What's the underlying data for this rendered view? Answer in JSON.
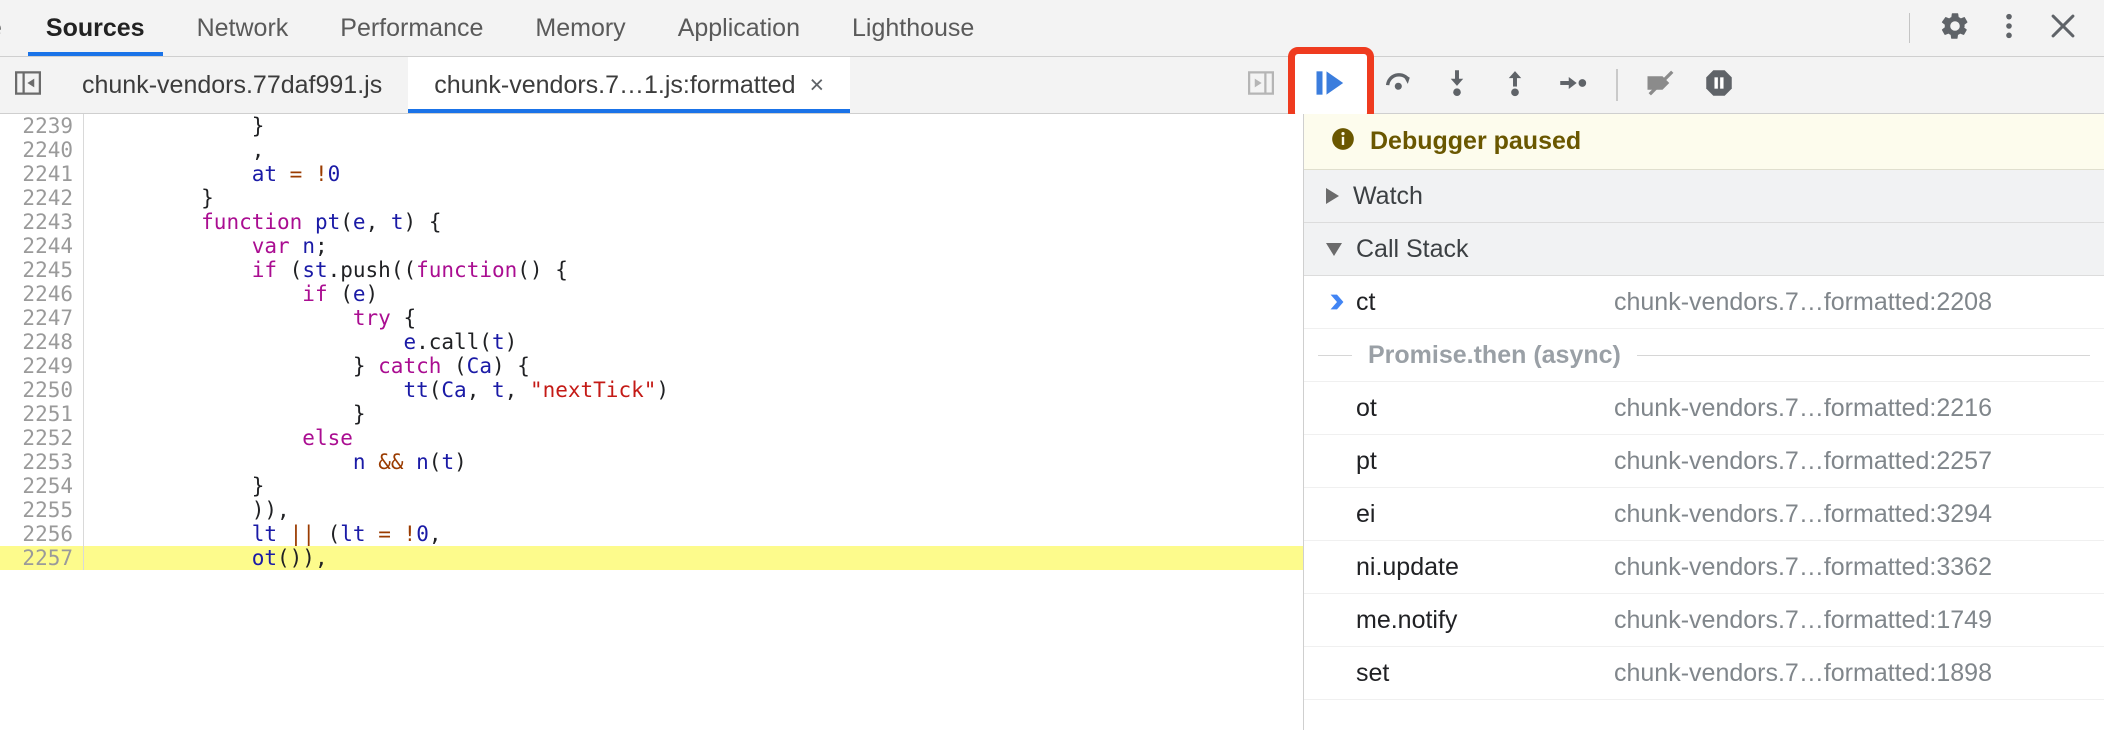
{
  "panel_tabs": [
    {
      "label": "e",
      "selected": false,
      "clipped": true
    },
    {
      "label": "Sources",
      "selected": true
    },
    {
      "label": "Network",
      "selected": false
    },
    {
      "label": "Performance",
      "selected": false
    },
    {
      "label": "Memory",
      "selected": false
    },
    {
      "label": "Application",
      "selected": false
    },
    {
      "label": "Lighthouse",
      "selected": false
    }
  ],
  "panel_actions": {
    "settings": "gear-icon",
    "more": "kebab-menu-icon",
    "close": "close-icon"
  },
  "file_tabs": {
    "navigator_toggle": "show-navigator-icon",
    "tabs": [
      {
        "label": "chunk-vendors.77daf991.js",
        "active": false,
        "closable": false
      },
      {
        "label": "chunk-vendors.7…1.js:formatted",
        "active": true,
        "closable": true,
        "close_glyph": "×"
      }
    ]
  },
  "debugger_toolbar": {
    "buttons": [
      {
        "name": "show-debugger-sidebar",
        "title": "Show debugger sidebar",
        "highlighted": false
      },
      {
        "name": "resume-script-execution",
        "title": "Resume script execution",
        "highlighted": true
      },
      {
        "name": "step-over-next-function-call",
        "title": "Step over next function call",
        "highlighted": false
      },
      {
        "name": "step-into-next-function-call",
        "title": "Step into next function call",
        "highlighted": false
      },
      {
        "name": "step-out-of-current-function",
        "title": "Step out of current function",
        "highlighted": false
      },
      {
        "name": "step",
        "title": "Step",
        "highlighted": false
      },
      {
        "name": "deactivate-breakpoints",
        "title": "Deactivate breakpoints",
        "highlighted": false
      },
      {
        "name": "pause-on-exceptions",
        "title": "Pause on exceptions",
        "highlighted": false
      }
    ],
    "annotation_color": "#ef3b1f",
    "resume_color": "#3b7ddd"
  },
  "editor": {
    "execution_line": 2257,
    "execution_highlight_color": "#fdfb8c",
    "lines": [
      {
        "n": 2239,
        "tokens": [
          {
            "t": "            }",
            "c": "p"
          }
        ]
      },
      {
        "n": 2240,
        "tokens": [
          {
            "t": "            ,",
            "c": "p"
          }
        ]
      },
      {
        "n": 2241,
        "tokens": [
          {
            "t": "            ",
            "c": "p"
          },
          {
            "t": "at",
            "c": "v"
          },
          {
            "t": " ",
            "c": "p"
          },
          {
            "t": "=",
            "c": "o"
          },
          {
            "t": " ",
            "c": "p"
          },
          {
            "t": "!",
            "c": "o"
          },
          {
            "t": "0",
            "c": "v"
          }
        ]
      },
      {
        "n": 2242,
        "tokens": [
          {
            "t": "        }",
            "c": "p"
          }
        ]
      },
      {
        "n": 2243,
        "tokens": [
          {
            "t": "        ",
            "c": "p"
          },
          {
            "t": "function",
            "c": "k"
          },
          {
            "t": " ",
            "c": "p"
          },
          {
            "t": "pt",
            "c": "v"
          },
          {
            "t": "(",
            "c": "p"
          },
          {
            "t": "e",
            "c": "v"
          },
          {
            "t": ", ",
            "c": "p"
          },
          {
            "t": "t",
            "c": "v"
          },
          {
            "t": ") {",
            "c": "p"
          }
        ]
      },
      {
        "n": 2244,
        "tokens": [
          {
            "t": "            ",
            "c": "p"
          },
          {
            "t": "var",
            "c": "k"
          },
          {
            "t": " ",
            "c": "p"
          },
          {
            "t": "n",
            "c": "v"
          },
          {
            "t": ";",
            "c": "p"
          }
        ]
      },
      {
        "n": 2245,
        "tokens": [
          {
            "t": "            ",
            "c": "p"
          },
          {
            "t": "if",
            "c": "k"
          },
          {
            "t": " (",
            "c": "p"
          },
          {
            "t": "st",
            "c": "v"
          },
          {
            "t": ".push((",
            "c": "p"
          },
          {
            "t": "function",
            "c": "k"
          },
          {
            "t": "() {",
            "c": "p"
          }
        ]
      },
      {
        "n": 2246,
        "tokens": [
          {
            "t": "                ",
            "c": "p"
          },
          {
            "t": "if",
            "c": "k"
          },
          {
            "t": " (",
            "c": "p"
          },
          {
            "t": "e",
            "c": "v"
          },
          {
            "t": ")",
            "c": "p"
          }
        ]
      },
      {
        "n": 2247,
        "tokens": [
          {
            "t": "                    ",
            "c": "p"
          },
          {
            "t": "try",
            "c": "k"
          },
          {
            "t": " {",
            "c": "p"
          }
        ]
      },
      {
        "n": 2248,
        "tokens": [
          {
            "t": "                        ",
            "c": "p"
          },
          {
            "t": "e",
            "c": "v"
          },
          {
            "t": ".call(",
            "c": "p"
          },
          {
            "t": "t",
            "c": "v"
          },
          {
            "t": ")",
            "c": "p"
          }
        ]
      },
      {
        "n": 2249,
        "tokens": [
          {
            "t": "                    } ",
            "c": "p"
          },
          {
            "t": "catch",
            "c": "k"
          },
          {
            "t": " (",
            "c": "p"
          },
          {
            "t": "Ca",
            "c": "v"
          },
          {
            "t": ") {",
            "c": "p"
          }
        ]
      },
      {
        "n": 2250,
        "tokens": [
          {
            "t": "                        ",
            "c": "p"
          },
          {
            "t": "tt",
            "c": "v"
          },
          {
            "t": "(",
            "c": "p"
          },
          {
            "t": "Ca",
            "c": "v"
          },
          {
            "t": ", ",
            "c": "p"
          },
          {
            "t": "t",
            "c": "v"
          },
          {
            "t": ", ",
            "c": "p"
          },
          {
            "t": "\"nextTick\"",
            "c": "s"
          },
          {
            "t": ")",
            "c": "p"
          }
        ]
      },
      {
        "n": 2251,
        "tokens": [
          {
            "t": "                    }",
            "c": "p"
          }
        ]
      },
      {
        "n": 2252,
        "tokens": [
          {
            "t": "                ",
            "c": "p"
          },
          {
            "t": "else",
            "c": "k"
          }
        ]
      },
      {
        "n": 2253,
        "tokens": [
          {
            "t": "                    ",
            "c": "p"
          },
          {
            "t": "n",
            "c": "v"
          },
          {
            "t": " ",
            "c": "p"
          },
          {
            "t": "&&",
            "c": "o"
          },
          {
            "t": " ",
            "c": "p"
          },
          {
            "t": "n",
            "c": "v"
          },
          {
            "t": "(",
            "c": "p"
          },
          {
            "t": "t",
            "c": "v"
          },
          {
            "t": ")",
            "c": "p"
          }
        ]
      },
      {
        "n": 2254,
        "tokens": [
          {
            "t": "            }",
            "c": "p"
          }
        ]
      },
      {
        "n": 2255,
        "tokens": [
          {
            "t": "            )),",
            "c": "p"
          }
        ]
      },
      {
        "n": 2256,
        "tokens": [
          {
            "t": "            ",
            "c": "p"
          },
          {
            "t": "lt",
            "c": "v"
          },
          {
            "t": " ",
            "c": "p"
          },
          {
            "t": "||",
            "c": "o"
          },
          {
            "t": " (",
            "c": "p"
          },
          {
            "t": "lt",
            "c": "v"
          },
          {
            "t": " ",
            "c": "p"
          },
          {
            "t": "=",
            "c": "o"
          },
          {
            "t": " ",
            "c": "p"
          },
          {
            "t": "!",
            "c": "o"
          },
          {
            "t": "0",
            "c": "v"
          },
          {
            "t": ",",
            "c": "p"
          }
        ]
      },
      {
        "n": 2257,
        "tokens": [
          {
            "t": "            ",
            "c": "p"
          },
          {
            "t": "ot",
            "c": "v"
          },
          {
            "t": "()),",
            "c": "p"
          }
        ]
      }
    ]
  },
  "sidebar": {
    "paused_banner": {
      "icon": "info-icon",
      "text": "Debugger paused"
    },
    "sections": [
      {
        "name": "watch",
        "label": "Watch",
        "expanded": false
      },
      {
        "name": "call-stack",
        "label": "Call Stack",
        "expanded": true
      }
    ],
    "call_stack": [
      {
        "type": "frame",
        "name": "ct",
        "location": "chunk-vendors.7…formatted:2208",
        "selected": true
      },
      {
        "type": "async",
        "label": "Promise.then (async)"
      },
      {
        "type": "frame",
        "name": "ot",
        "location": "chunk-vendors.7…formatted:2216",
        "selected": false
      },
      {
        "type": "frame",
        "name": "pt",
        "location": "chunk-vendors.7…formatted:2257",
        "selected": false
      },
      {
        "type": "frame",
        "name": "ei",
        "location": "chunk-vendors.7…formatted:3294",
        "selected": false
      },
      {
        "type": "frame",
        "name": "ni.update",
        "location": "chunk-vendors.7…formatted:3362",
        "selected": false
      },
      {
        "type": "frame",
        "name": "me.notify",
        "location": "chunk-vendors.7…formatted:1749",
        "selected": false
      },
      {
        "type": "frame",
        "name": "set",
        "location": "chunk-vendors.7…formatted:1898",
        "selected": false
      }
    ]
  }
}
